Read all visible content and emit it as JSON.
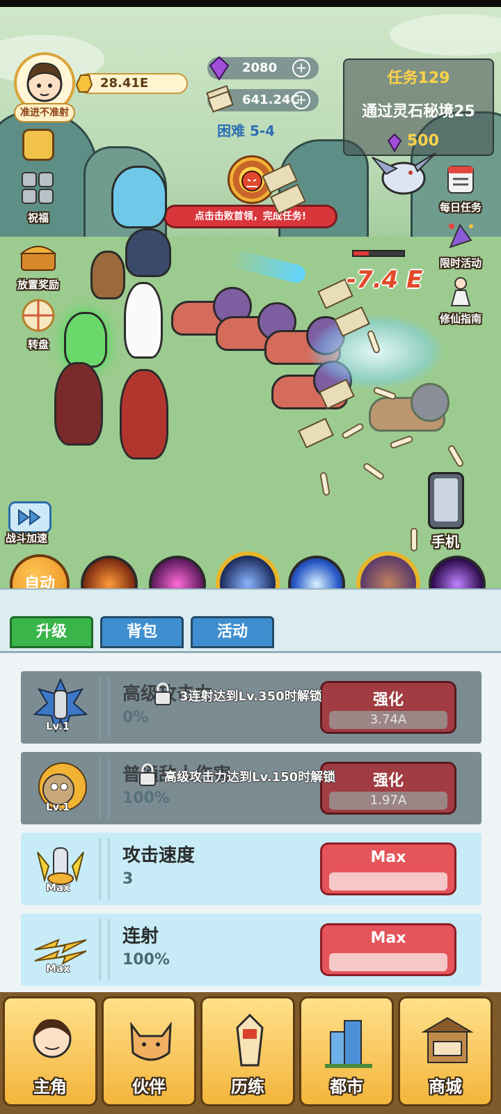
{
  "player": {
    "nickname": "准进不准射",
    "gold": "28.41E"
  },
  "resources": {
    "gems": "2080",
    "cash": "641.24C",
    "stage": "困难 5-4"
  },
  "task": {
    "title": "任务129",
    "description": "通过灵石秘境25",
    "reward": "500"
  },
  "left_menu": [
    {
      "label": "祝福"
    },
    {
      "label": "放置奖励"
    },
    {
      "label": "转盘"
    }
  ],
  "right_menu": [
    {
      "label": "每日任务"
    },
    {
      "label": "限时活动"
    },
    {
      "label": "修仙指南"
    }
  ],
  "battle": {
    "boss_banner": "点击击败首领，完成任务!",
    "damage_text": "-7.4 E",
    "enemy_hp_fraction": 0.3,
    "speed_label": "战斗加速",
    "phone_label": "手机"
  },
  "skills": {
    "auto_label": "自动"
  },
  "tabs": [
    {
      "label": "升级",
      "active": true
    },
    {
      "label": "背包",
      "active": false
    },
    {
      "label": "活动",
      "active": false
    }
  ],
  "upgrades": [
    {
      "name": "高级攻击力",
      "value": "0%",
      "level": "Lv.1",
      "button": "强化",
      "cost": "3.74A",
      "locked": true,
      "lock_message": "3连射达到Lv.350时解锁"
    },
    {
      "name": "普通敌人伤害",
      "value": "100%",
      "level": "Lv.1",
      "button": "强化",
      "cost": "1.97A",
      "locked": true,
      "lock_message": "高级攻击力达到Lv.150时解锁"
    },
    {
      "name": "攻击速度",
      "value": "3",
      "level": "Max",
      "button": "Max",
      "cost": "",
      "locked": false,
      "lock_message": ""
    },
    {
      "name": "连射",
      "value": "100%",
      "level": "Max",
      "button": "Max",
      "cost": "",
      "locked": false,
      "lock_message": ""
    }
  ],
  "nav": [
    {
      "label": "主角",
      "icon": "hero-icon"
    },
    {
      "label": "伙伴",
      "icon": "cat-icon"
    },
    {
      "label": "历练",
      "icon": "trial-icon"
    },
    {
      "label": "都市",
      "icon": "city-icon"
    },
    {
      "label": "商城",
      "icon": "shop-icon"
    }
  ],
  "colors": {
    "accent_green": "#39b54a",
    "tab_blue": "#3f8fd0",
    "button_red": "#e4545a",
    "gold": "#ffd24a"
  }
}
